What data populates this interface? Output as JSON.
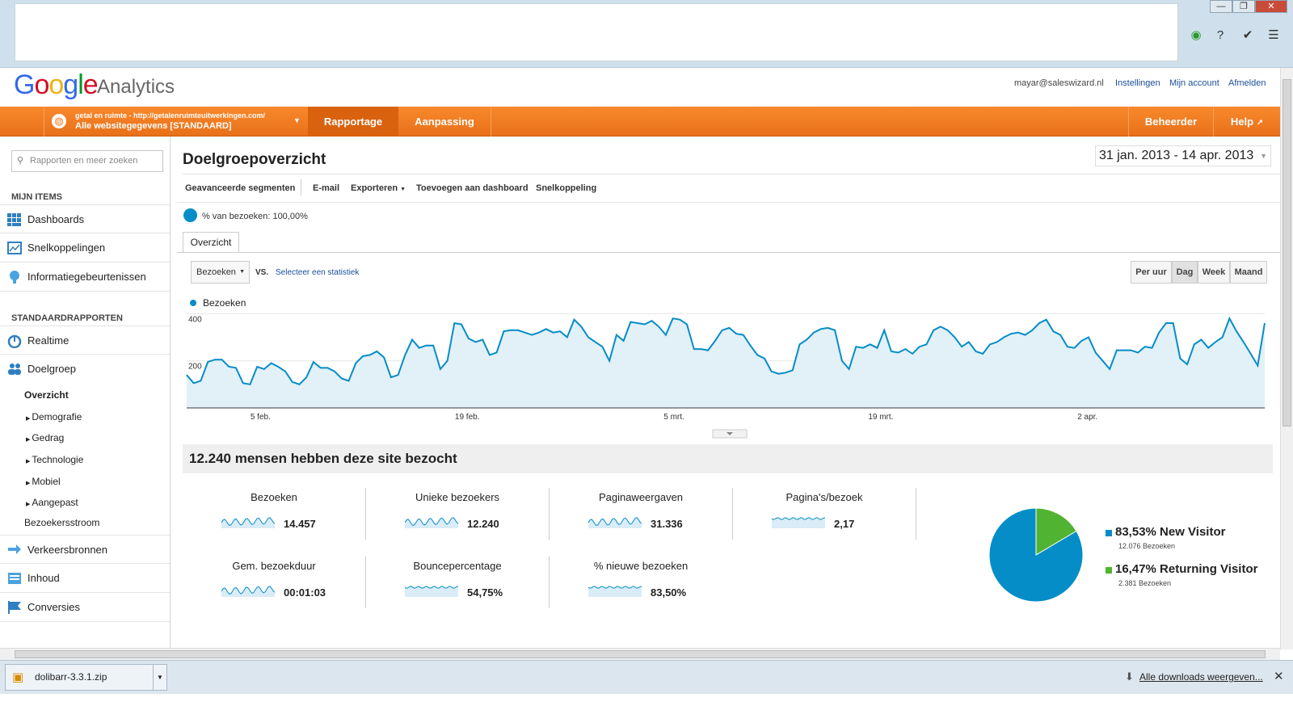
{
  "header": {
    "logo_google": "Google",
    "logo_analytics": "Analytics",
    "email": "mayar@saleswizard.nl",
    "links": [
      "Instellingen",
      "Mijn account",
      "Afmelden"
    ]
  },
  "nav": {
    "property_line1": "getal en ruimte - http://getalenruimteuitwerkingen.com/",
    "property_line2": "Alle websitegegevens [STANDAARD]",
    "tabs": [
      "Rapportage",
      "Aanpassing"
    ],
    "right": [
      "Beheerder",
      "Help"
    ]
  },
  "sidebar": {
    "search_placeholder": "Rapporten en meer zoeken",
    "section_my": "MIJN ITEMS",
    "my_items": [
      "Dashboards",
      "Snelkoppelingen",
      "Informatiegebeurtenissen"
    ],
    "section_std": "STANDAARDRAPPORTEN",
    "realtime": "Realtime",
    "doelgroep": "Doelgroep",
    "overzicht": "Overzicht",
    "sub_items": [
      "Demografie",
      "Gedrag",
      "Technologie",
      "Mobiel",
      "Aangepast"
    ],
    "bezoekersstroom": "Bezoekersstroom",
    "bottom_items": [
      "Verkeersbronnen",
      "Inhoud",
      "Conversies"
    ]
  },
  "main": {
    "title": "Doelgroepoverzicht",
    "date_range": "31 jan. 2013 - 14 apr. 2013",
    "toolbar": [
      "Geavanceerde segmenten",
      "E-mail",
      "Exporteren",
      "Toevoegen aan dashboard",
      "Snelkoppeling"
    ],
    "segment": "% van bezoeken: 100,00%",
    "tab": "Overzicht",
    "metric_select": "Bezoeken",
    "vs": "VS.",
    "select_stat": "Selecteer een statistiek",
    "granularity": [
      "Per uur",
      "Dag",
      "Week",
      "Maand"
    ],
    "granularity_selected": "Dag",
    "summary": "12.240 mensen hebben deze site bezocht"
  },
  "chart_data": {
    "type": "area",
    "series": [
      {
        "name": "Bezoeken",
        "color": "#058dc7",
        "values": [
          140,
          105,
          115,
          195,
          205,
          205,
          175,
          170,
          105,
          100,
          175,
          165,
          190,
          175,
          155,
          110,
          100,
          130,
          195,
          170,
          170,
          155,
          125,
          115,
          190,
          220,
          225,
          240,
          215,
          130,
          140,
          225,
          290,
          255,
          265,
          265,
          165,
          200,
          360,
          355,
          295,
          280,
          290,
          225,
          235,
          325,
          330,
          330,
          320,
          310,
          320,
          335,
          320,
          325,
          300,
          375,
          345,
          300,
          280,
          260,
          200,
          310,
          285,
          365,
          360,
          355,
          370,
          345,
          310,
          380,
          375,
          355,
          250,
          250,
          245,
          285,
          330,
          340,
          315,
          310,
          265,
          225,
          210,
          155,
          145,
          150,
          160,
          270,
          290,
          320,
          335,
          340,
          330,
          200,
          165,
          260,
          255,
          270,
          255,
          330,
          240,
          235,
          250,
          230,
          260,
          270,
          330,
          345,
          330,
          300,
          260,
          280,
          240,
          230,
          270,
          280,
          300,
          315,
          320,
          310,
          330,
          360,
          375,
          325,
          310,
          260,
          255,
          285,
          300,
          235,
          200,
          165,
          245,
          245,
          245,
          235,
          260,
          255,
          320,
          360,
          360,
          210,
          185,
          270,
          290,
          255,
          280,
          300,
          380,
          325,
          280,
          230,
          180,
          360
        ]
      }
    ],
    "x_tick_labels": [
      "5 feb.",
      "19 feb.",
      "5 mrt.",
      "19 mrt.",
      "2 apr."
    ],
    "y_tick_labels": [
      "200",
      "400"
    ],
    "ylim": [
      0,
      400
    ],
    "legend": "top-left"
  },
  "metrics": [
    {
      "label": "Bezoeken",
      "value": "14.457"
    },
    {
      "label": "Unieke bezoekers",
      "value": "12.240"
    },
    {
      "label": "Paginaweergaven",
      "value": "31.336"
    },
    {
      "label": "Pagina's/bezoek",
      "value": "2,17"
    },
    {
      "label": "Gem. bezoekduur",
      "value": "00:01:03"
    },
    {
      "label": "Bouncepercentage",
      "value": "54,75%"
    },
    {
      "label": "% nieuwe bezoeken",
      "value": "83,50%"
    }
  ],
  "pie": {
    "slices": [
      {
        "label": "New Visitor",
        "pct": "83,53%",
        "sub": "12.076 Bezoeken",
        "value": 83.53,
        "color": "#058dc7"
      },
      {
        "label": "Returning Visitor",
        "pct": "16,47%",
        "sub": "2.381 Bezoeken",
        "value": 16.47,
        "color": "#50b432"
      }
    ]
  },
  "downloads": {
    "file": "dolibarr-3.3.1.zip",
    "all_link": "Alle downloads weergeven..."
  },
  "colors": {
    "accent": "#f57c20",
    "link": "#1a4e9c",
    "series": "#058dc7"
  }
}
